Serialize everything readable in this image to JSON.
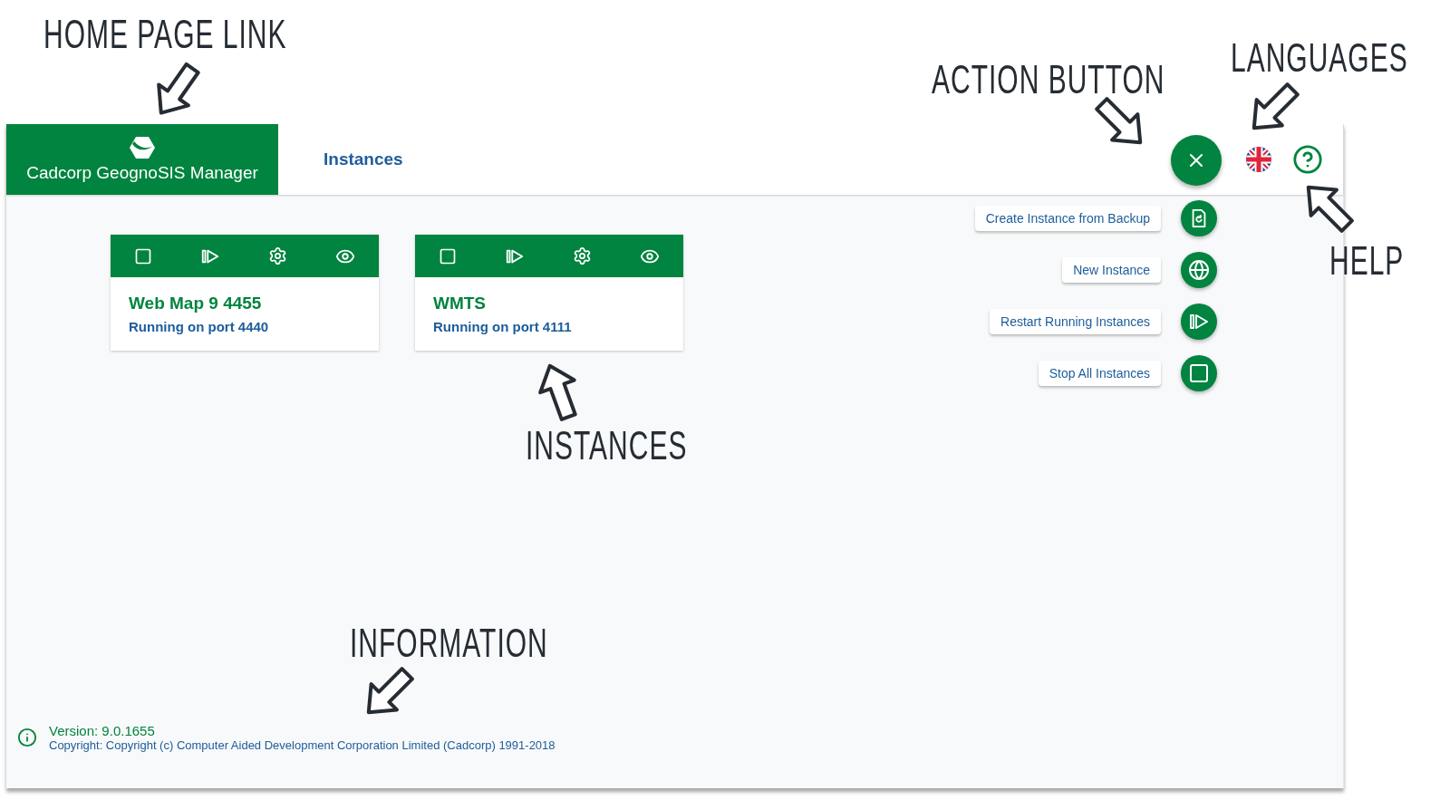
{
  "annotations": [
    {
      "text": "HOME PAGE LINK"
    },
    {
      "text": "ACTION BUTTON"
    },
    {
      "text": "LANGUAGES"
    },
    {
      "text": "HELP"
    },
    {
      "text": "INSTANCES"
    },
    {
      "text": "INFORMATION"
    }
  ],
  "header": {
    "logo_text": "Cadcorp GeognoSIS Manager",
    "nav": [
      {
        "label": "Instances"
      }
    ]
  },
  "action_button": {
    "expanded": true
  },
  "speed_dial": [
    {
      "label": "Create Instance from Backup",
      "kind": "backup"
    },
    {
      "label": "New Instance",
      "kind": "new"
    },
    {
      "label": "Restart Running Instances",
      "kind": "restart"
    },
    {
      "label": "Stop All Instances",
      "kind": "stop"
    }
  ],
  "instances": [
    {
      "name": "Web Map 9 4455",
      "status": "Running on port 4440"
    },
    {
      "name": "WMTS",
      "status": "Running on port 4111"
    }
  ],
  "footer": {
    "version": "Version: 9.0.1655",
    "copyright": "Copyright: Copyright (c) Computer Aided Development Corporation Limited (Cadcorp) 1991-2018"
  }
}
